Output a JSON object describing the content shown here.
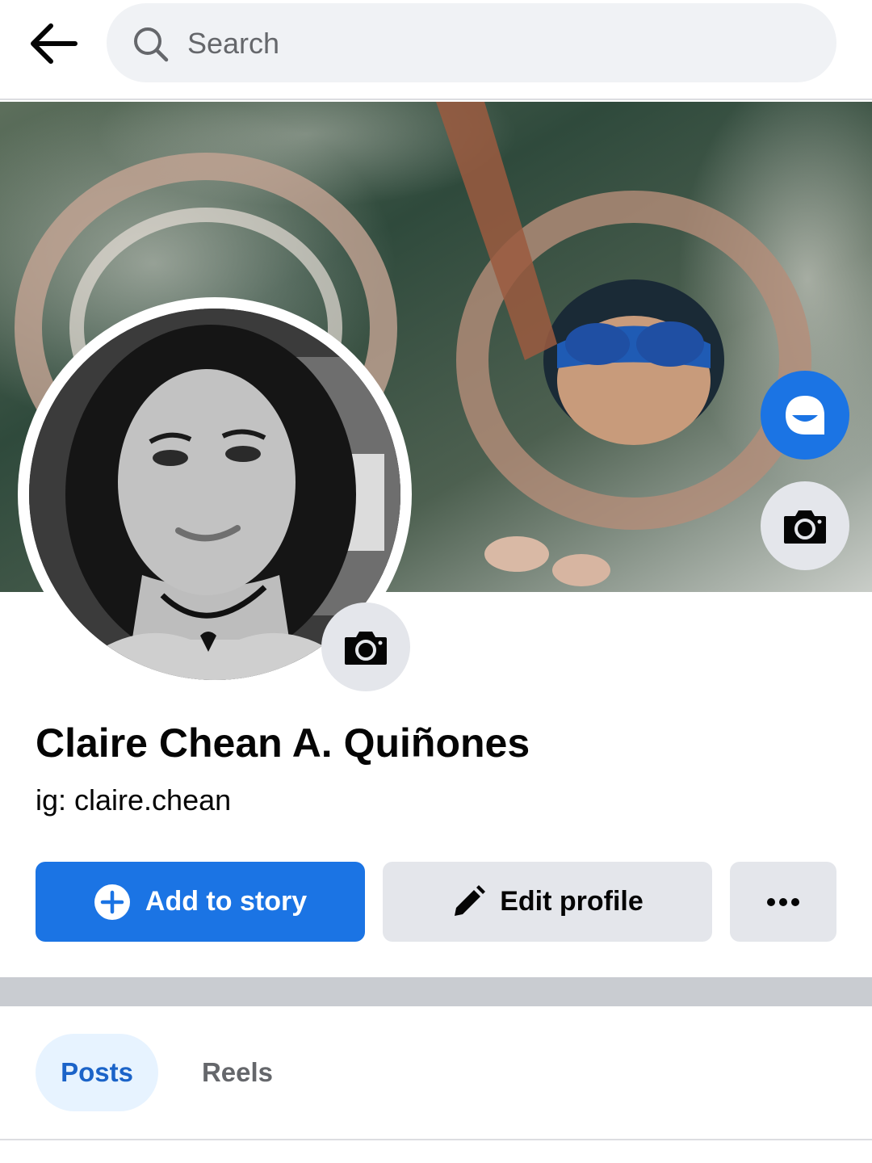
{
  "header": {
    "search_placeholder": "Search"
  },
  "profile": {
    "name": "Claire Chean A. Quiñones",
    "bio": "ig: claire.chean"
  },
  "actions": {
    "add_story": "Add to story",
    "edit_profile": "Edit profile"
  },
  "tabs": [
    {
      "label": "Posts",
      "active": true
    },
    {
      "label": "Reels",
      "active": false
    }
  ],
  "icons": {
    "back": "arrow-left-icon",
    "search": "search-icon",
    "avatar": "avatar-icon",
    "camera": "camera-icon",
    "add": "plus-circle-icon",
    "edit": "pencil-icon",
    "more": "more-icon"
  },
  "colors": {
    "accent": "#1b74e4",
    "tab_active_bg": "#e7f3ff",
    "tab_active_text": "#1b63c8",
    "button_gray": "#e4e6eb"
  }
}
